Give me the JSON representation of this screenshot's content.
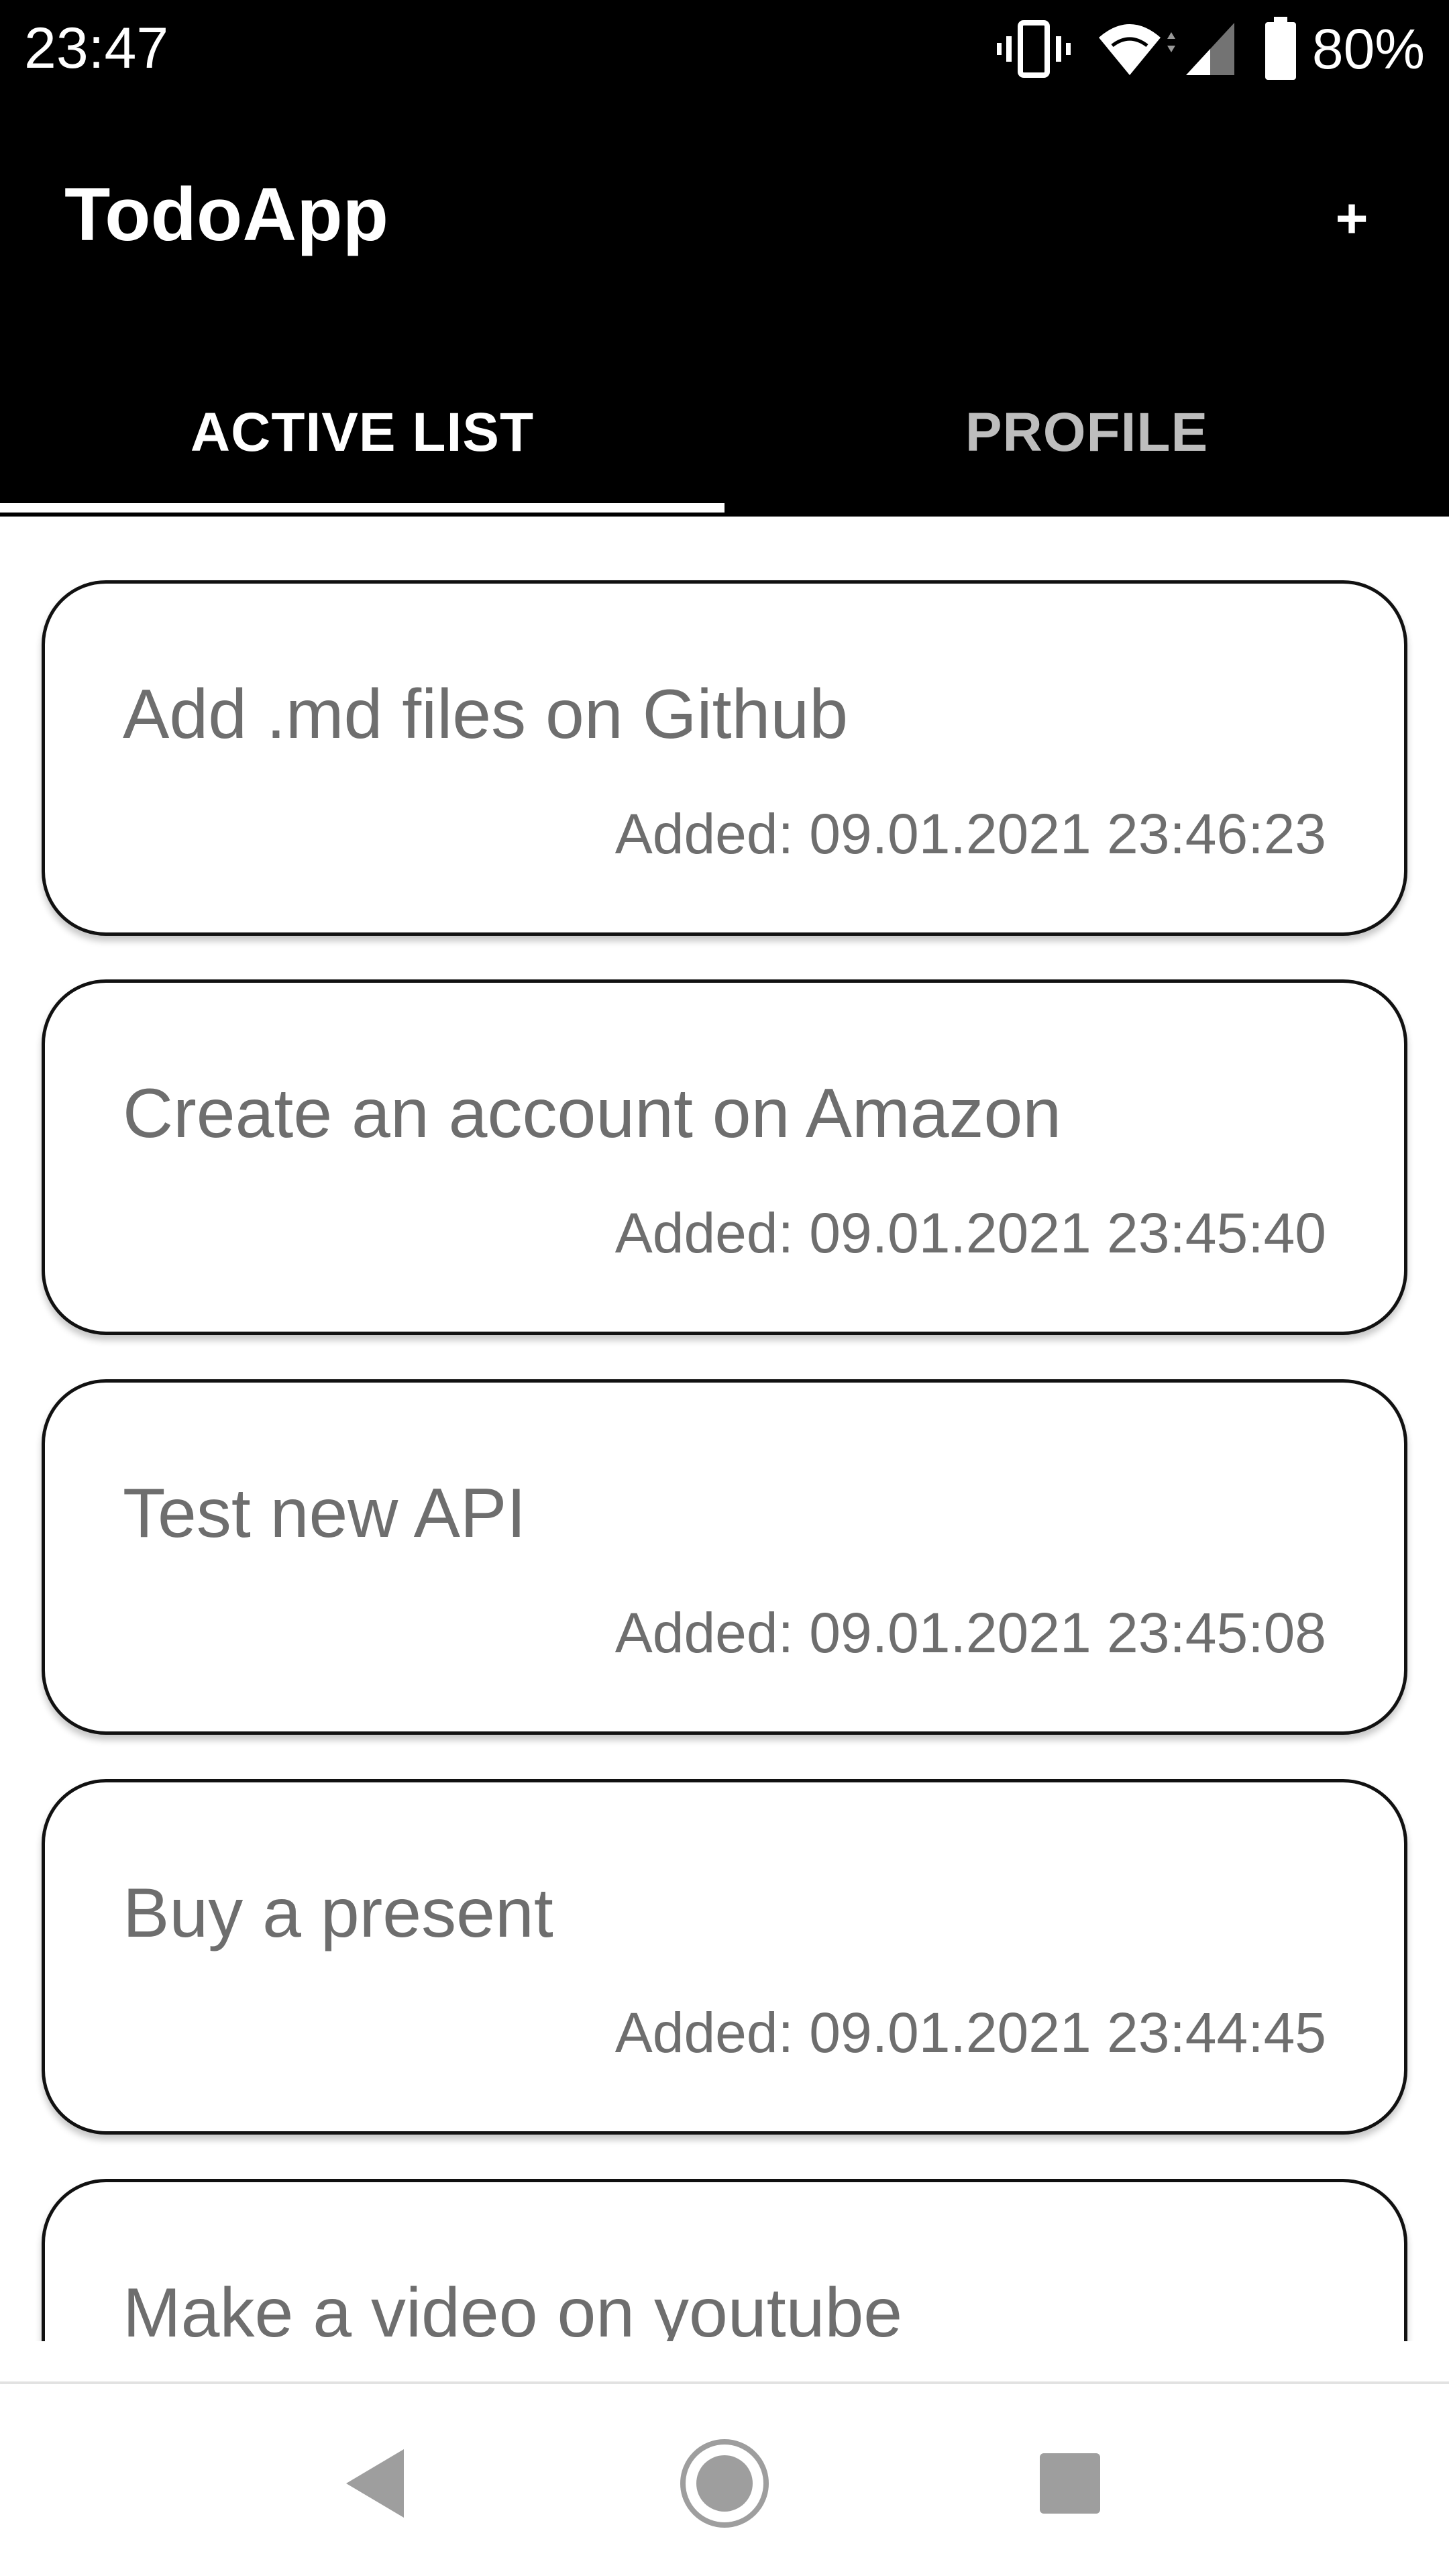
{
  "status_bar": {
    "time": "23:47",
    "battery_percent": "80%",
    "icons": [
      "vibrate-icon",
      "wifi-icon",
      "cell-signal-icon",
      "battery-icon"
    ]
  },
  "app": {
    "title": "TodoApp",
    "add_label": "+"
  },
  "tabs": [
    {
      "label": "ACTIVE LIST",
      "selected": true
    },
    {
      "label": "PROFILE",
      "selected": false
    }
  ],
  "todos": [
    {
      "title": "Add .md files on Github",
      "added": "Added: 09.01.2021 23:46:23"
    },
    {
      "title": "Create an account on Amazon",
      "added": "Added: 09.01.2021 23:45:40"
    },
    {
      "title": "Test new API",
      "added": "Added: 09.01.2021 23:45:08"
    },
    {
      "title": "Buy a present",
      "added": "Added: 09.01.2021 23:44:45"
    },
    {
      "title": "Make a video on youtube",
      "added": ""
    }
  ],
  "nav": {
    "icons": [
      "back-icon",
      "home-icon",
      "recents-icon"
    ]
  },
  "colors": {
    "app_bar": "#000000",
    "tab_active": "#ffffff",
    "tab_inactive": "#bdbdbd",
    "card_text": "#6e6e6e",
    "card_border": "#111111",
    "nav_icon": "#9e9e9e"
  }
}
